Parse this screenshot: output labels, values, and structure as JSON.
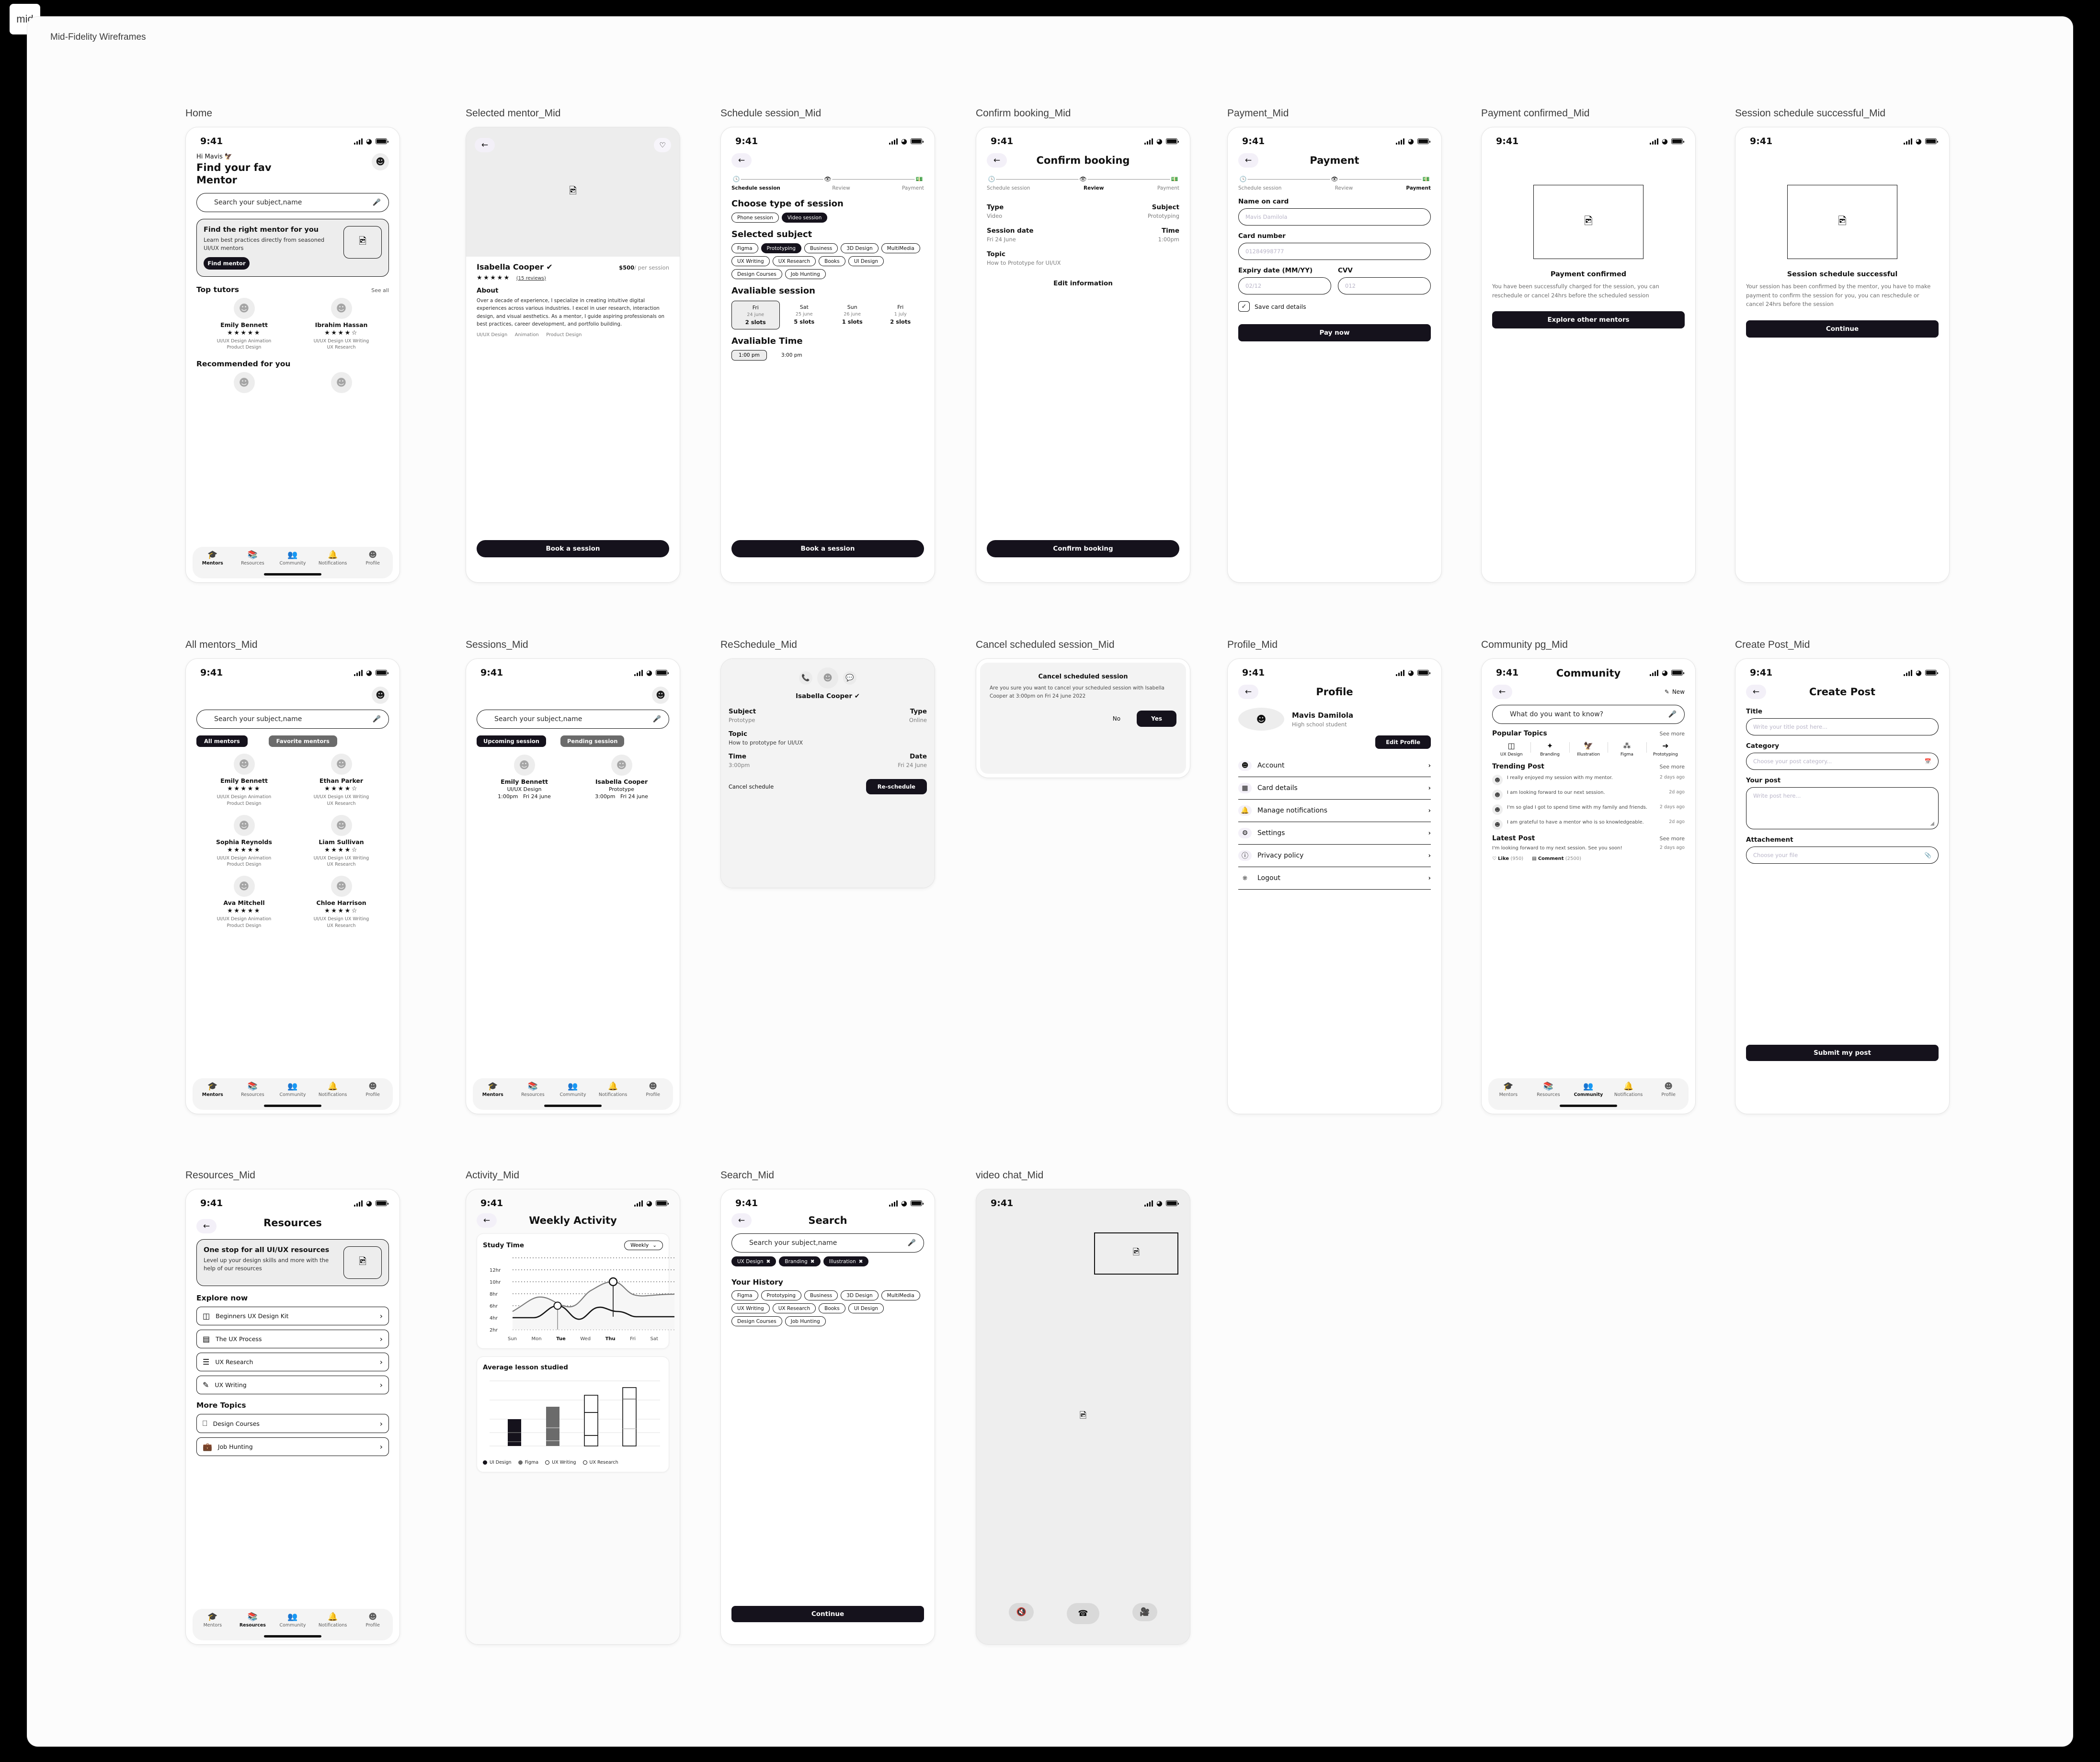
{
  "tab_label": "mid",
  "canvas_title": "Mid-Fidelity Wireframes",
  "common": {
    "status_time": "9:41",
    "search_placeholder": "Search your subject,name",
    "book_session": "Book a session",
    "tabbar": [
      {
        "label": "Mentors",
        "icon": "graduation-cap-icon"
      },
      {
        "label": "Resources",
        "icon": "books-icon"
      },
      {
        "label": "Community",
        "icon": "people-icon"
      },
      {
        "label": "Notifications",
        "icon": "bell-icon"
      },
      {
        "label": "Profile",
        "icon": "person-icon"
      }
    ],
    "stepper": [
      "Schedule session",
      "Review",
      "Payment"
    ]
  },
  "screens": {
    "home": {
      "label": "Home",
      "greeting": "Hi Mavis",
      "title_line1": "Find your fav",
      "title_line2": "Mentor",
      "promo_title": "Find the right mentor for you",
      "promo_text": "Learn best practices directly from seasoned UI/UX mentors",
      "promo_cta": "Find mentor",
      "top_tutors": "Top tutors",
      "see_all": "See all",
      "recommended": "Recommended for you",
      "tutors": [
        {
          "name": "Emily Bennett",
          "rating": 5,
          "tags": "UI/UX Design    Animation\nProduct Design"
        },
        {
          "name": "Ibrahim Hassan",
          "rating": 4,
          "tags": "UI/UX Design    UX Writing\nUX Research"
        }
      ]
    },
    "selected_mentor": {
      "label": "Selected mentor_Mid",
      "name": "Isabella Cooper",
      "price": "$500",
      "price_unit": "/ per session",
      "rating": 5,
      "reviews": "(15 reviews)",
      "about_title": "About",
      "about_text": "Over a decade of experience, I specialize in creating intuitive digital experiences across various industries. I excel in user research, interaction design, and visual aesthetics. As a mentor, I guide aspiring professionals on best practices, career development, and portfolio building.",
      "tags": "UI/UX Design     Animation     Product Design"
    },
    "schedule": {
      "label": "Schedule session_Mid",
      "choose_type": "Choose type of session",
      "types": [
        "Phone session",
        "Video session"
      ],
      "type_selected": "Video session",
      "selected_subject": "Selected subject",
      "subjects": [
        "Figma",
        "Prototyping",
        "Business",
        "3D Design",
        "MultiMedia",
        "UX Writing",
        "UX Research",
        "Books",
        "UI Design",
        "Design Courses",
        "Job Hunting"
      ],
      "subject_selected": "Prototyping",
      "available_session": "Avaliable session",
      "slots": [
        {
          "day": "Fri",
          "date": "24 june",
          "slots": "2 slots",
          "selected": true
        },
        {
          "day": "Sat",
          "date": "25 june",
          "slots": "5 slots",
          "selected": false
        },
        {
          "day": "Sun",
          "date": "26 june",
          "slots": "1 slots",
          "selected": false
        },
        {
          "day": "Fri",
          "date": "1 july",
          "slots": "2 slots",
          "selected": false
        }
      ],
      "available_time": "Avaliable Time",
      "times": [
        "1:00 pm",
        "3:00 pm"
      ],
      "time_selected": "1:00 pm"
    },
    "confirm_booking": {
      "label": "Confirm booking_Mid",
      "title": "Confirm booking",
      "fields": [
        {
          "k": "Type",
          "v": "Video",
          "k2": "Subject",
          "v2": "Prototyping"
        },
        {
          "k": "Session date",
          "v": "Fri 24 June",
          "k2": "Time",
          "v2": "1:00pm"
        }
      ],
      "topic_label": "Topic",
      "topic_value": "How to Prototype for UI/UX",
      "edit": "Edit information",
      "cta": "Confirm booking"
    },
    "payment": {
      "label": "Payment_Mid",
      "title": "Payment",
      "name_label": "Name on card",
      "name_placeholder": "Mavis Damilola",
      "card_label": "Card number",
      "card_placeholder": "01284998777",
      "expiry_label": "Expiry date (MM/YY)",
      "expiry_placeholder": "02/12",
      "cvv_label": "CVV",
      "cvv_placeholder": "012",
      "save_card": "Save card details",
      "cta": "Pay now"
    },
    "payment_confirmed": {
      "label": "Payment confirmed_Mid",
      "title": "Payment confirmed",
      "text": "You have been successfully charged for the session, you can reschedule or cancel 24hrs before the scheduled session",
      "cta": "Explore other mentors"
    },
    "session_success": {
      "label": "Session schedule successful_Mid",
      "title": "Session schedule successful",
      "text": "Your session has been confirmed by the mentor, you have to make payment to confirm the session for you, you can reschedule or cancel 24hrs before the session",
      "cta": "Continue"
    },
    "all_mentors": {
      "label": "All mentors_Mid",
      "filters": [
        "All mentors",
        "Favorite mentors"
      ],
      "filter_selected": "All mentors",
      "mentors": [
        {
          "name": "Emily Bennett",
          "rating": 5,
          "tags": "UI/UX Design    Animation\nProduct Design"
        },
        {
          "name": "Ethan Parker",
          "rating": 4,
          "tags": "UI/UX Design    UX Writing\nUX Research"
        },
        {
          "name": "Sophia Reynolds",
          "rating": 5,
          "tags": "UI/UX Design    Animation\nProduct Design"
        },
        {
          "name": "Liam Sullivan",
          "rating": 4,
          "tags": "UI/UX Design    UX Writing\nUX Research"
        },
        {
          "name": "Ava Mitchell",
          "rating": 5,
          "tags": "UI/UX Design    Animation\nProduct Design"
        },
        {
          "name": "Chloe Harrison",
          "rating": 4,
          "tags": "UI/UX Design    UX Writing\nUX Research"
        }
      ]
    },
    "sessions": {
      "label": "Sessions_Mid",
      "filters": [
        "Upcoming session",
        "Pending session"
      ],
      "filter_selected": "Upcoming session",
      "items": [
        {
          "name": "Emily Bennett",
          "subject": "UI/UX Design",
          "when": "1:00pm   Fri 24 june"
        },
        {
          "name": "Isabella Cooper",
          "subject": "Prototype",
          "when": "3:00pm   Fri 24 june"
        }
      ]
    },
    "reschedule": {
      "label": "ReSchedule_Mid",
      "name": "Isabella Cooper",
      "subject_label": "Subject",
      "subject_value": "Prototype",
      "type_label": "Type",
      "type_value": "Online",
      "topic_label": "Topic",
      "topic_value": "How to prototype for UI/UX",
      "time_label": "Time",
      "time_value": "3:00pm",
      "date_label": "Date",
      "date_value": "Fri 24 June",
      "cancel": "Cancel schedule",
      "reschedule": "Re-schedule"
    },
    "cancel_session": {
      "label": "Cancel scheduled session_Mid",
      "title": "Cancel scheduled session",
      "text": "Are you sure you want to cancel your scheduled session with Isabella Cooper at 3:00pm on Fri 24 june 2022",
      "no": "No",
      "yes": "Yes"
    },
    "profile": {
      "label": "Profile_Mid",
      "title": "Profile",
      "name": "Mavis Damilola",
      "role": "High school student",
      "edit": "Edit Profile",
      "items": [
        {
          "label": "Account",
          "icon": "person-icon"
        },
        {
          "label": "Card details",
          "icon": "card-icon"
        },
        {
          "label": "Manage notifications",
          "icon": "bell-icon"
        },
        {
          "label": "Settings",
          "icon": "gear-icon"
        },
        {
          "label": "Privacy policy",
          "icon": "shield-icon"
        },
        {
          "label": "Logout",
          "icon": "power-icon"
        }
      ]
    },
    "community": {
      "label": "Community pg_Mid",
      "title": "Community",
      "new": "New",
      "search_placeholder": "What do you want to know?",
      "popular_title": "Popular Topics",
      "see_more": "See more",
      "topics": [
        {
          "label": "UX Design",
          "icon": "layout-icon"
        },
        {
          "label": "Branding",
          "icon": "brand-icon"
        },
        {
          "label": "Illustration",
          "icon": "bird-icon"
        },
        {
          "label": "Figma",
          "icon": "figma-icon"
        },
        {
          "label": "Prototyping",
          "icon": "flow-icon"
        }
      ],
      "trending_title": "Trending Post",
      "trending": [
        {
          "text": "I really enjoyed my session with my mentor.",
          "time": "2 days ago"
        },
        {
          "text": "I am looking forward to our next session.",
          "time": "2d ago"
        },
        {
          "text": "I'm so glad I got to spend time with my family and friends.",
          "time": "2 days ago"
        },
        {
          "text": "I am grateful to have a mentor who is so knowledgeable.",
          "time": "2d ago"
        }
      ],
      "latest_title": "Latest Post",
      "latest_text": "I'm looking forward to my next session. See you soon!",
      "latest_time": "2 days ago",
      "like": "Like",
      "like_count": "(950)",
      "comment": "Comment",
      "comment_count": "(2500)"
    },
    "create_post": {
      "label": "Create Post_Mid",
      "title": "Create Post",
      "title_label": "Title",
      "title_placeholder": "Write your title post here...",
      "category_label": "Category",
      "category_placeholder": "Choose your post category...",
      "post_label": "Your post",
      "post_placeholder": "Write post here...",
      "attachment_label": "Attachement",
      "attachment_placeholder": "Choose your file",
      "cta": "Submit my post"
    },
    "resources": {
      "label": "Resources_Mid",
      "title": "Resources",
      "promo_title": "One stop for all UI/UX resources",
      "promo_text": "Level up your design skills and more with the help of our resources",
      "explore_title": "Explore now",
      "explore": [
        {
          "label": "Beginners UX Design Kit",
          "icon": "box-icon"
        },
        {
          "label": "The UX Process",
          "icon": "flow-icon"
        },
        {
          "label": "UX Research",
          "icon": "doc-icon"
        },
        {
          "label": "UX Writing",
          "icon": "pen-icon"
        }
      ],
      "more_title": "More Topics",
      "more": [
        {
          "label": "Design Courses",
          "icon": "laptop-icon"
        },
        {
          "label": "Job Hunting",
          "icon": "briefcase-icon"
        }
      ]
    },
    "activity": {
      "label": "Activity_Mid",
      "title": "Weekly Activity",
      "range": "Weekly"
    },
    "search": {
      "label": "Search_Mid",
      "title": "Search",
      "active_filters": [
        "UX Design",
        "Branding",
        "Illustration"
      ],
      "history_title": "Your History",
      "history": [
        "Figma",
        "Prototyping",
        "Business",
        "3D Design",
        "MultiMedia",
        "UX Writing",
        "UX Research",
        "Books",
        "UI Design",
        "Design Courses",
        "Job Hunting"
      ],
      "cta": "Continue"
    },
    "video_chat": {
      "label": "video chat_Mid",
      "controls": [
        "mic-off-icon",
        "end-call-icon",
        "video-off-icon"
      ]
    }
  },
  "chart_data": [
    {
      "type": "area",
      "title": "Study Time",
      "categories": [
        "Sun",
        "Mon",
        "Tue",
        "Wed",
        "Thu",
        "Fri",
        "Sat"
      ],
      "series": [
        {
          "name": "series-gray",
          "values": [
            5,
            7,
            6,
            8,
            10,
            8,
            8
          ]
        },
        {
          "name": "series-black",
          "values": [
            4,
            4,
            6,
            4,
            6.5,
            5,
            5
          ]
        }
      ],
      "ytick_labels": [
        "2hr",
        "4hr",
        "6hr",
        "8hr",
        "10hr",
        "12hr"
      ],
      "ylim": [
        1,
        13
      ],
      "markers": [
        {
          "x": "Tue",
          "y": 6
        },
        {
          "x": "Thu",
          "y": 10
        }
      ],
      "highlighted_ticks": [
        "Tue",
        "Thu"
      ],
      "grid": true,
      "legend": "none"
    },
    {
      "type": "bar",
      "title": "Average lesson studied",
      "categories": [
        "UI Design",
        "Figma",
        "UX Writing",
        "UX Research"
      ],
      "values": [
        52,
        72,
        86,
        100
      ],
      "segments": [
        [
          18,
          48,
          52
        ],
        [
          8,
          48,
          72
        ],
        [
          22,
          68,
          86
        ],
        [
          40,
          82,
          100
        ]
      ],
      "colors": [
        "#15121c",
        "#6b6b6b",
        "#ffffff",
        "#ffffff"
      ],
      "legend": [
        "UI Design",
        "Figma",
        "UX Writing",
        "UX Research"
      ],
      "grid": true,
      "ylim": [
        0,
        110
      ]
    }
  ]
}
